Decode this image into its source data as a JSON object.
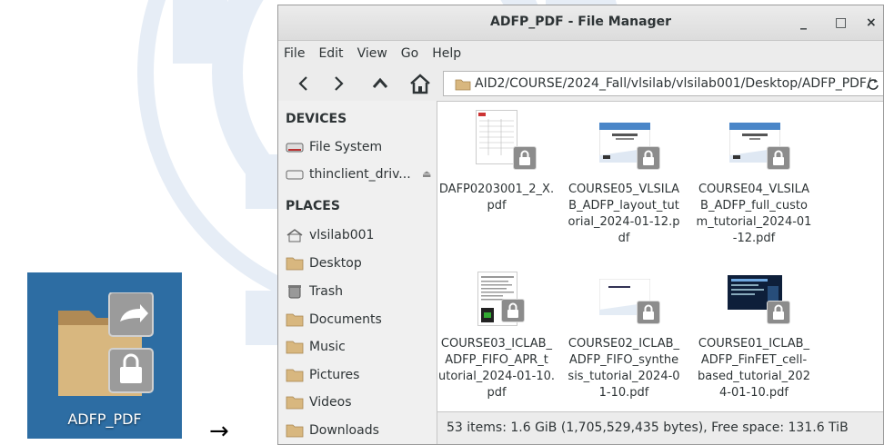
{
  "desktop": {
    "icon_label": "ADFP_PDF",
    "arrow": "→"
  },
  "window": {
    "title": "ADFP_PDF - File Manager",
    "controls": {
      "minimize": "_",
      "maximize": "□",
      "close": "×"
    }
  },
  "menu": [
    "File",
    "Edit",
    "View",
    "Go",
    "Help"
  ],
  "toolbar": {
    "path": "AID2/COURSE/2024_Fall/vlsilab/vlsilab001/Desktop/ADFP_PDF/"
  },
  "sidebar": {
    "devices_header": "DEVICES",
    "devices": [
      {
        "label": "File System",
        "icon": "drive-icon"
      },
      {
        "label": "thinclient_driv...",
        "icon": "drive-icon"
      }
    ],
    "places_header": "PLACES",
    "places": [
      {
        "label": "vlsilab001",
        "icon": "home-icon"
      },
      {
        "label": "Desktop",
        "icon": "folder-icon"
      },
      {
        "label": "Trash",
        "icon": "trash-icon"
      },
      {
        "label": "Documents",
        "icon": "folder-icon"
      },
      {
        "label": "Music",
        "icon": "folder-icon"
      },
      {
        "label": "Pictures",
        "icon": "folder-icon"
      },
      {
        "label": "Videos",
        "icon": "folder-icon"
      },
      {
        "label": "Downloads",
        "icon": "folder-icon"
      }
    ]
  },
  "files": [
    {
      "name": "DAFP0203001_2_X.pdf",
      "lines": [
        "DAFP0203001_2_X.",
        "pdf"
      ]
    },
    {
      "name": "COURSE05_VLSILAB_ADFP_layout_tutorial_2024-01-12.pdf",
      "lines": [
        "COURSE05_VLSILA",
        "B_ADFP_layout_tut",
        "orial_2024-01-12.p",
        "df"
      ]
    },
    {
      "name": "COURSE04_VLSILAB_ADFP_full_custom_tutorial_2024-01-12.pdf",
      "lines": [
        "COURSE04_VLSILA",
        "B_ADFP_full_custo",
        "m_tutorial_2024-01",
        "-12.pdf"
      ]
    },
    {
      "name": "COURSE03_ICLAB_ADFP_FIFO_APR_tutorial_2024-01-10.pdf",
      "lines": [
        "COURSE03_ICLAB_",
        "ADFP_FIFO_APR_t",
        "utorial_2024-01-10.",
        "pdf"
      ]
    },
    {
      "name": "COURSE02_ICLAB_ADFP_FIFO_synthesis_tutorial_2024-01-10.pdf",
      "lines": [
        "COURSE02_ICLAB_",
        "ADFP_FIFO_synthe",
        "sis_tutorial_2024-0",
        "1-10.pdf"
      ]
    },
    {
      "name": "COURSE01_ICLAB_ADFP_FinFET_cell-based_tutorial_2024-01-10.pdf",
      "lines": [
        "COURSE01_ICLAB_",
        "ADFP_FinFET_cell-",
        "based_tutorial_202",
        "4-01-10.pdf"
      ]
    }
  ],
  "status": "53 items: 1.6 GiB (1,705,529,435 bytes), Free space: 131.6 TiB",
  "colors": {
    "desktop_bg": "#2d6da3",
    "folder": "#c8a36a",
    "lock_badge": "#8c8c8c"
  }
}
